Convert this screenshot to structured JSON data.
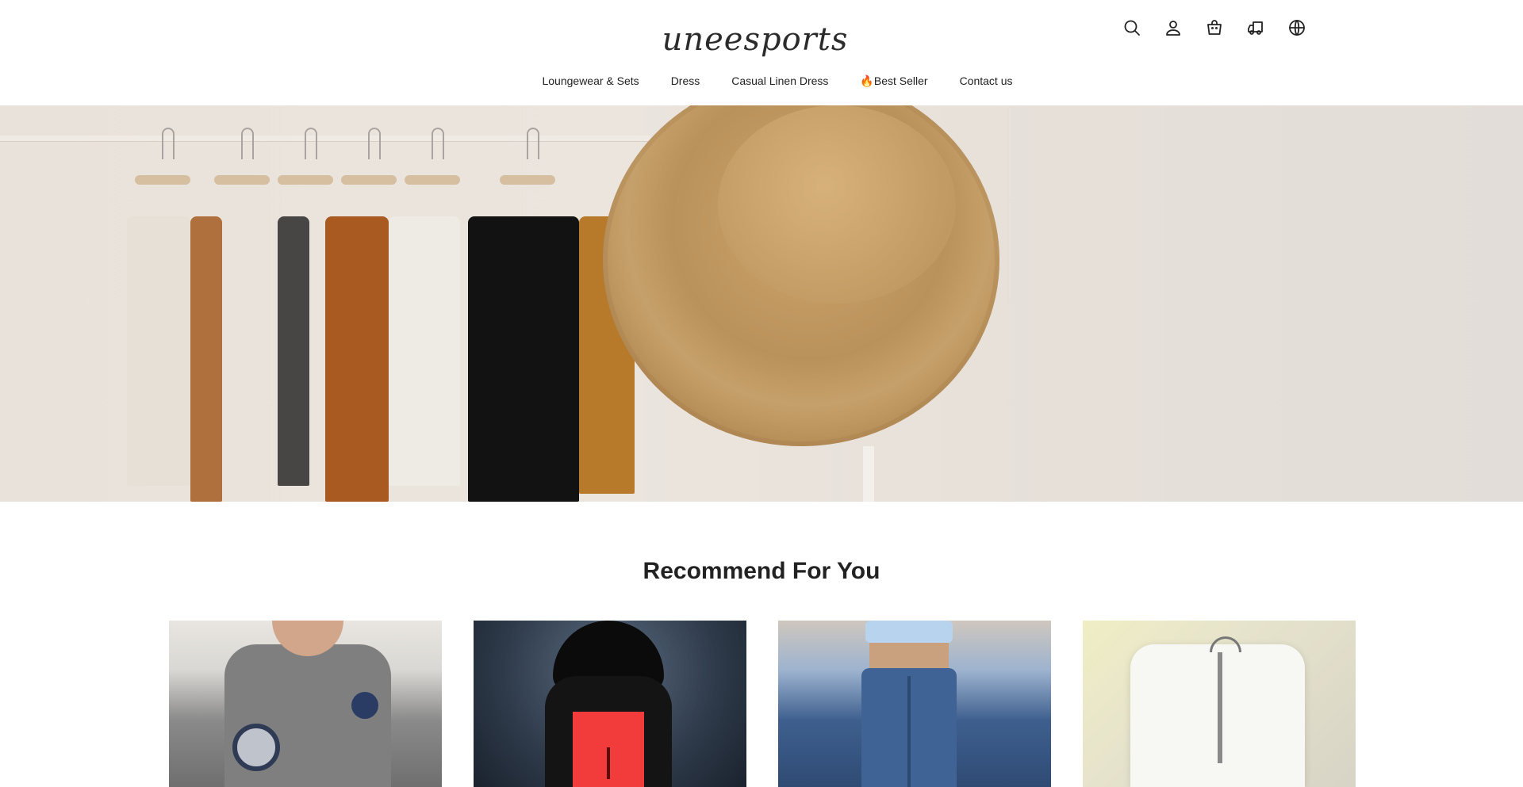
{
  "header": {
    "logo_text": "uneesports",
    "icons": [
      {
        "name": "search-icon"
      },
      {
        "name": "account-icon"
      },
      {
        "name": "cart-icon"
      },
      {
        "name": "shipping-icon"
      },
      {
        "name": "globe-icon"
      }
    ]
  },
  "nav": {
    "items": [
      {
        "label": "Loungewear & Sets"
      },
      {
        "label": "Dress"
      },
      {
        "label": "Casual Linen Dress"
      },
      {
        "label": "🔥Best Seller"
      },
      {
        "label": "Contact us"
      }
    ]
  },
  "recommend": {
    "title": "Recommend For You"
  }
}
